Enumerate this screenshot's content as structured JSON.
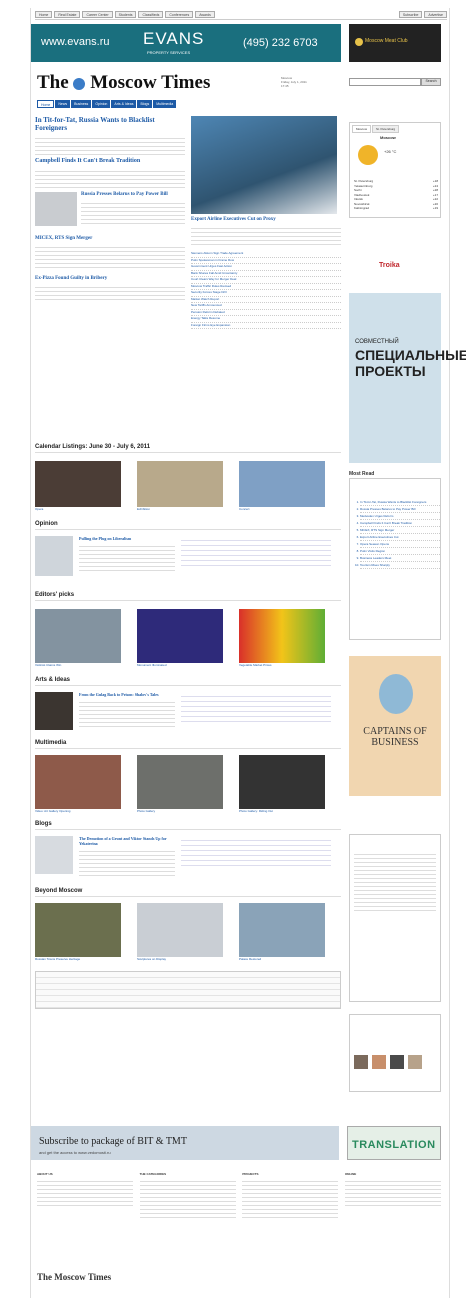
{
  "topnav": {
    "items": [
      "Home",
      "Real Estate",
      "Career Center",
      "Students",
      "Classifieds",
      "Conferences",
      "Awards"
    ],
    "right": [
      "Subscribe",
      "Advertise"
    ]
  },
  "banner": {
    "left": "www.evans.ru",
    "brand": "EVANS",
    "brand_sub": "PROPERTY SERVICES",
    "phone": "(495) 232 6703"
  },
  "adtop": {
    "text": "Moscow Meat Club"
  },
  "logo": {
    "text_a": "The",
    "text_b": "Moscow Times"
  },
  "tabs": [
    "Home",
    "News",
    "Business",
    "Opinion",
    "Arts & Ideas",
    "Blogs",
    "Multimedia"
  ],
  "search": {
    "button": "Search"
  },
  "headerright": {
    "weather": "Moscow",
    "date": "Friday, July 1, 2011",
    "time": "17:45"
  },
  "main": {
    "lead1": {
      "title": "In Tit-for-Tat, Russia Wants to Blacklist Foreigners"
    },
    "lead2": {
      "title": "Campbell Finds It Can't Break Tradition"
    },
    "lead3": {
      "title": "Russia Presses Belarus to Pay Power Bill"
    },
    "lead4": {
      "title": "MICEX, RTS Sign Merger"
    },
    "lead5": {
      "title": "Ex-Pizza Found Guilty in Bribery"
    },
    "feature": {
      "title": "Export Airline Executives Cut on Proxy"
    },
    "list": [
      "Siemens Alstom Sign Trade Agreement",
      "Putin Spokesman in Frame Row",
      "Government Urges Fast Action",
      "Bank Shares Fall Amid Uncertainty",
      "Court Clears Way for Merger Deal",
      "Moscow Traffic Rules Revised",
      "Security Forces Stage Drill",
      "Market Watch Report",
      "New Tariffs Announced",
      "Pension Reform Debated",
      "Energy Talks Resume",
      "Foreign Firms Eye Expansion"
    ]
  },
  "sections": {
    "calendar": "Calendar Listings: June 30 - July 6, 2011",
    "opinion": "Opinion",
    "editors": "Editors' picks",
    "arts": "Arts & Ideas",
    "multimedia": "Multimedia",
    "blogs": "Blogs",
    "beyond": "Beyond Moscow"
  },
  "opinion": {
    "title": "Pulling the Plug on Liberalism"
  },
  "arts": {
    "title": "From the Gulag Back to Prison: Shalov's Tales"
  },
  "blogs": {
    "title": "The Demotion of a Grunt and Viktor Stands Up for Yekaterina"
  },
  "captions": {
    "cal": [
      "Opera",
      "Exhibition",
      "Concert"
    ],
    "editors": [
      "Violinist Claims Win",
      "Monument Illuminated",
      "Vegetable Market Prices"
    ],
    "multimedia": [
      "Video: Art Gallery Opening",
      "Photo Gallery",
      "Photo Gallery: Riding Out"
    ],
    "beyond": [
      "Russian Towns Preserve Heritage",
      "Sculptures on Display",
      "Palace Restored"
    ]
  },
  "sidebar": {
    "tabs": [
      "Moscow",
      "St. Petersburg"
    ],
    "weather": {
      "city": "Moscow",
      "temp": "+26 °C",
      "cities": [
        "St. Petersburg",
        "Yekaterinburg",
        "Sochi",
        "Vladivostok",
        "Irkutsk",
        "Novosibirsk",
        "Kaliningrad"
      ],
      "temps": [
        "+18",
        "+24",
        "+28",
        "+17",
        "+22",
        "+20",
        "+19"
      ]
    },
    "troika": "Troika",
    "proekt1": "СОВМЕСТНЫЙ",
    "proekt2": "СПЕЦИАЛЬНЫЕ ПРОЕКТЫ",
    "mostread": "Most Read",
    "mostread_items": [
      "In Tit-for-Tat, Russia Wants to Blacklist Foreigners",
      "Russia Presses Belarus to Pay Power Bill",
      "Medvedev Urges Reform",
      "Campbell Finds It Can't Break Tradition",
      "MICEX, RTS Sign Merger",
      "Export Airline Executives Cut",
      "Opera Season Opens",
      "Putin Visits Region",
      "Business Leaders Meet",
      "Tourism Rises Sharply"
    ],
    "captains": "CAPTAINS OF BUSINESS"
  },
  "footer": {
    "subscribe": "Subscribe to package of BIT & TMT",
    "subscribe_sub": "and get the access to www.vedomosti.ru",
    "translation": "TRANSLATION",
    "cols": [
      "ABOUT US",
      "THE CATEGORIES",
      "PROJECTS",
      "ONLINE"
    ],
    "logo": "The Moscow Times"
  }
}
